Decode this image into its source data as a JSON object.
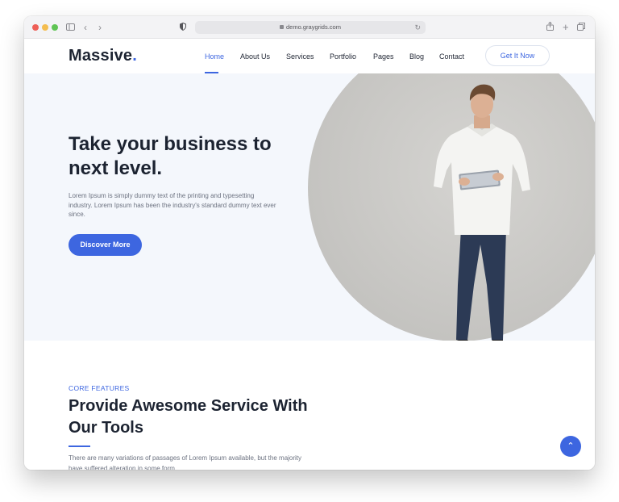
{
  "browser": {
    "url": "demo.graygrids.com",
    "icons": [
      "sidebar-icon",
      "back-icon",
      "forward-icon",
      "shield-icon",
      "lock-icon",
      "reload-icon",
      "share-icon",
      "new-tab-icon",
      "tabs-icon"
    ]
  },
  "nav": {
    "logo": "Massive",
    "logo_dot": ".",
    "links": [
      "Home",
      "About Us",
      "Services",
      "Portfolio",
      "Pages",
      "Blog",
      "Contact"
    ],
    "active": "Home",
    "cta": "Get It Now"
  },
  "hero": {
    "title": "Take your business to next level.",
    "description": "Lorem Ipsum is simply dummy text of the printing and typesetting industry. Lorem Ipsum has been the industry's standard dummy text ever since.",
    "button": "Discover More"
  },
  "features": {
    "eyebrow": "CORE FEATURES",
    "title": "Provide Awesome Service With Our Tools",
    "description": "There are many variations of passages of Lorem Ipsum available, but the majority have suffered alteration in some form."
  },
  "colors": {
    "accent": "#3d66e0",
    "heading": "#1c2331",
    "hero_bg": "#f4f7fc"
  }
}
